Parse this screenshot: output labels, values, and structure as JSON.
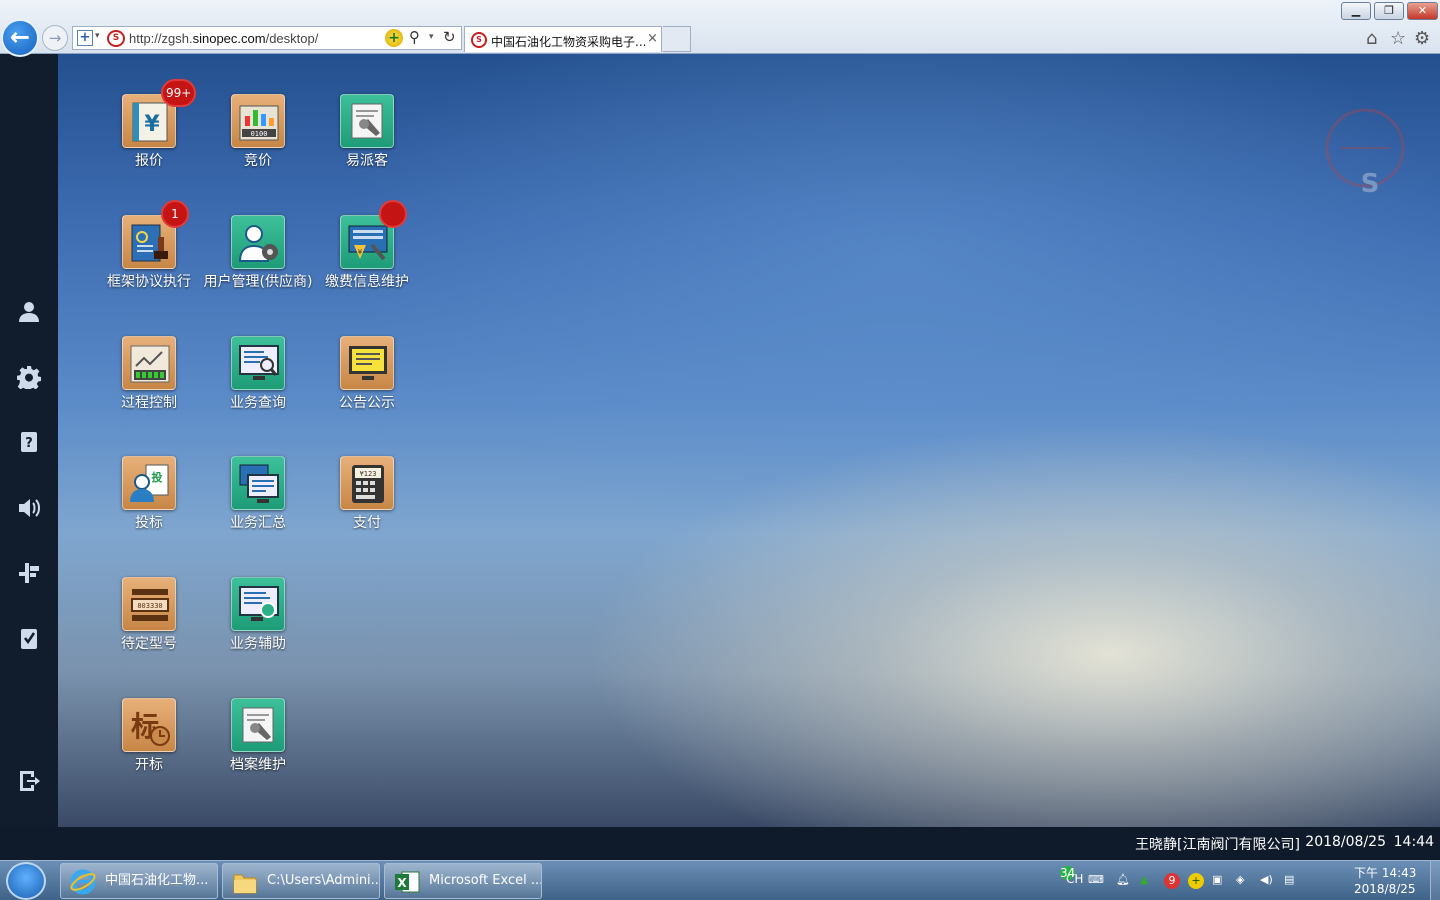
{
  "browser": {
    "url_prefix": "http://zgsh.",
    "url_domain": "sinopec.com",
    "url_suffix": "/desktop/",
    "tab_title": "中国石油化工物资采购电子...",
    "tab_close": "×",
    "back_glyph": "←",
    "forward_glyph": "→",
    "min_glyph": "▁",
    "max_glyph": "❐",
    "close_glyph": "✕"
  },
  "apps": [
    {
      "label": "报价",
      "badge": "99+",
      "style": "tan",
      "icon": "ledger-yen-icon"
    },
    {
      "label": "竞价",
      "badge": "",
      "style": "tan",
      "icon": "bar-chart-counter-icon"
    },
    {
      "label": "易派客",
      "badge": "",
      "style": "green",
      "icon": "document-wrench-icon"
    },
    {
      "label": "框架协议执行",
      "badge": "1",
      "style": "tan",
      "icon": "stamp-book-icon"
    },
    {
      "label": "用户管理(供应商)",
      "badge": "",
      "style": "green",
      "icon": "user-gear-icon"
    },
    {
      "label": "缴费信息维护",
      "badge": "•",
      "style": "green",
      "icon": "payment-monitor-icon"
    },
    {
      "label": "过程控制",
      "badge": "",
      "style": "tan",
      "icon": "process-chart-icon"
    },
    {
      "label": "业务查询",
      "badge": "",
      "style": "green",
      "icon": "monitor-search-icon"
    },
    {
      "label": "公告公示",
      "badge": "",
      "style": "tan",
      "icon": "notice-monitor-icon"
    },
    {
      "label": "投标",
      "badge": "",
      "style": "tan",
      "icon": "user-bid-icon"
    },
    {
      "label": "业务汇总",
      "badge": "",
      "style": "green",
      "icon": "monitors-stack-icon"
    },
    {
      "label": "支付",
      "badge": "",
      "style": "tan",
      "icon": "pos-terminal-icon"
    },
    {
      "label": "待定型号",
      "badge": "",
      "style": "tan",
      "icon": "model-code-icon"
    },
    {
      "label": "业务辅助",
      "badge": "",
      "style": "green",
      "icon": "monitor-refresh-icon"
    },
    {
      "label": "开标",
      "badge": "",
      "style": "tan",
      "icon": "bid-open-clock-icon"
    },
    {
      "label": "档案维护",
      "badge": "",
      "style": "green",
      "icon": "archive-wrench-icon"
    }
  ],
  "sidebar_icons": [
    "user-icon",
    "settings-gear-icon",
    "help-book-icon",
    "volume-icon",
    "layout-icon",
    "checklist-icon",
    "logout-icon"
  ],
  "status": {
    "user": "王晓静[江南阀门有限公司]",
    "date": "2018/08/25",
    "time": "14:44"
  },
  "taskbar": {
    "tasks": [
      "中国石油化工物...",
      "C:\\Users\\Admini...",
      "Microsoft Excel ..."
    ],
    "lang": "CH",
    "tray_badge": "34",
    "clock_time": "下午 14:43",
    "clock_date": "2018/8/25"
  },
  "colors": {
    "tile_tan": "#d9995c",
    "tile_green": "#2ab087",
    "badge_red": "#c41414",
    "sidebar": "#111c2d"
  }
}
